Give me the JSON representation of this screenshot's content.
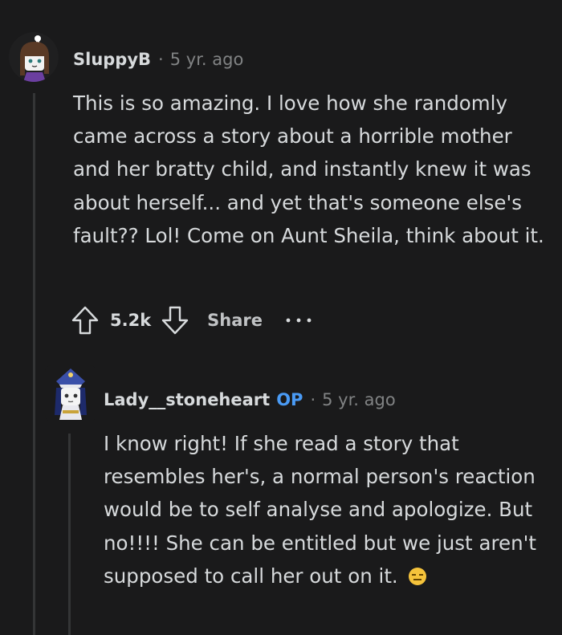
{
  "comments": [
    {
      "author": "SluppyB",
      "time": "5 yr. ago",
      "body": "This is so amazing. I love how she randomly came across a story about a horrible mother and her bratty child, and instantly knew it was about herself... and yet that's someone else's fault?? Lol! Come on Aunt Sheila, think about it.",
      "score": "5.2k",
      "share_label": "Share",
      "more_icon": "more-options-icon"
    },
    {
      "author": "Lady__stoneheart",
      "op_badge": "OP",
      "time": "5 yr. ago",
      "body": "I know right! If she read a story that resembles her's, a normal person's reaction would be to self analyse and apologize. But no!!!! She can be entitled but we just aren't supposed to call her out on it.",
      "emoji": "expressionless-face-emoji"
    }
  ],
  "colors": {
    "background": "#1a1a1b",
    "text": "#d7dadc",
    "meta": "#818384",
    "op": "#4a9bf5",
    "thread_line": "#343536"
  }
}
